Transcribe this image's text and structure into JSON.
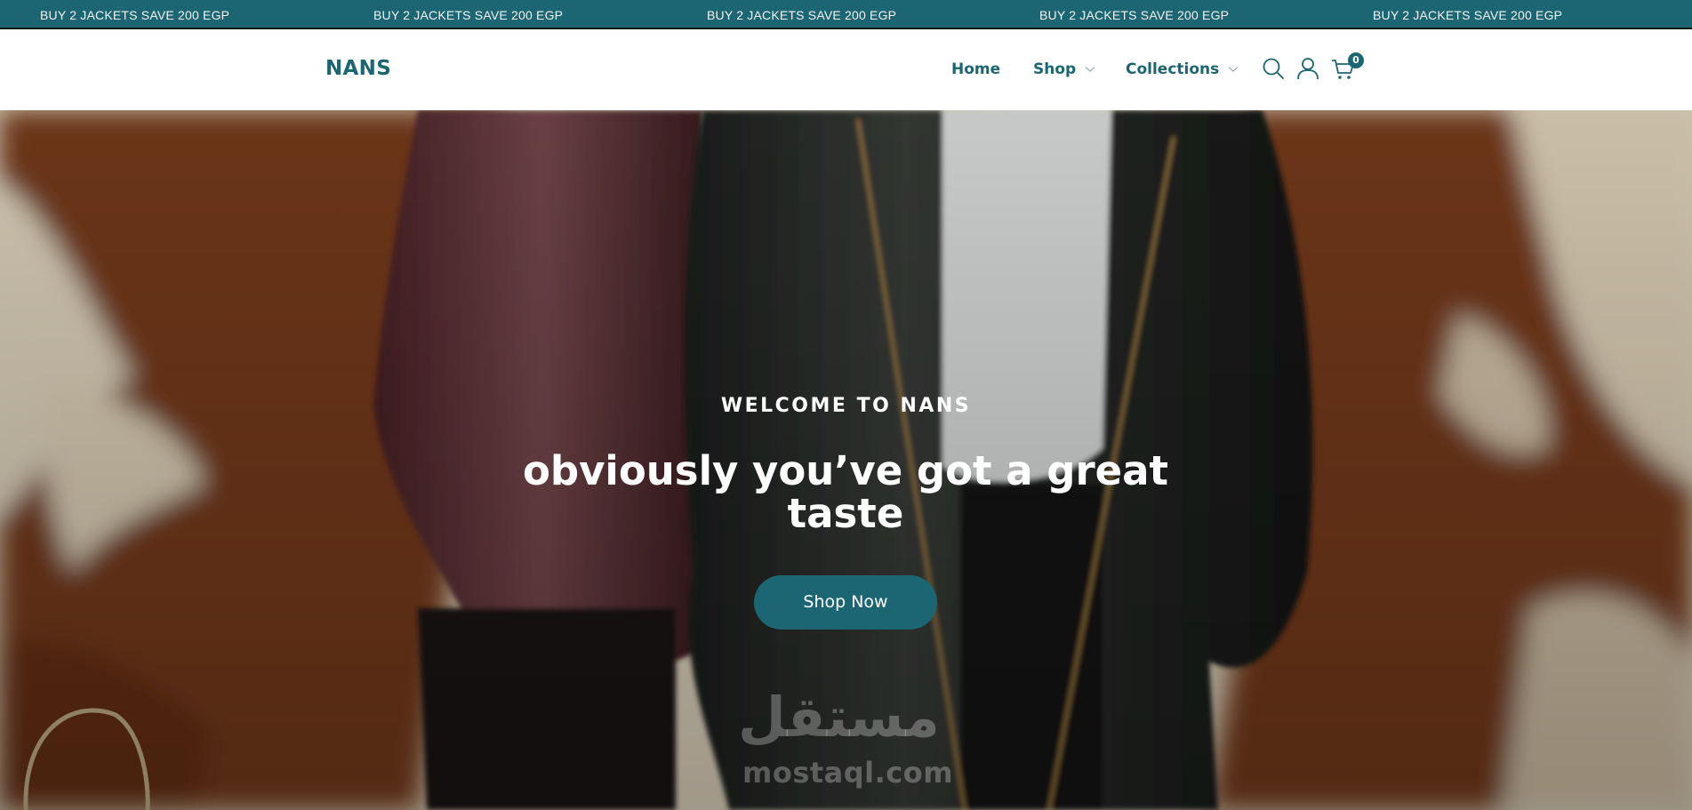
{
  "announcement": {
    "items": [
      "BUY 2 JACKETS SAVE 200 EGP",
      "BUY 2 JACKETS SAVE 200 EGP",
      "BUY 2 JACKETS SAVE 200 EGP",
      "BUY 2 JACKETS SAVE 200 EGP",
      "BUY 2 JACKETS SAVE 200 EGP"
    ]
  },
  "header": {
    "logo": "NANS",
    "nav": [
      {
        "label": "Home"
      },
      {
        "label": "Shop"
      },
      {
        "label": "Collections"
      }
    ],
    "icons": [
      "search-icon",
      "user-icon",
      "cart-icon"
    ],
    "cart_count": "0"
  },
  "hero": {
    "kicker": "WELCOME TO NANS",
    "title": "obviously you’ve got a great taste",
    "button": "Shop Now",
    "watermark_arabic": "مستقل",
    "watermark_latin": "mostaql.com"
  },
  "colors": {
    "brand": "#1b6672",
    "announce_text": "#f2f2f2",
    "hero_text": "#ffffff"
  }
}
